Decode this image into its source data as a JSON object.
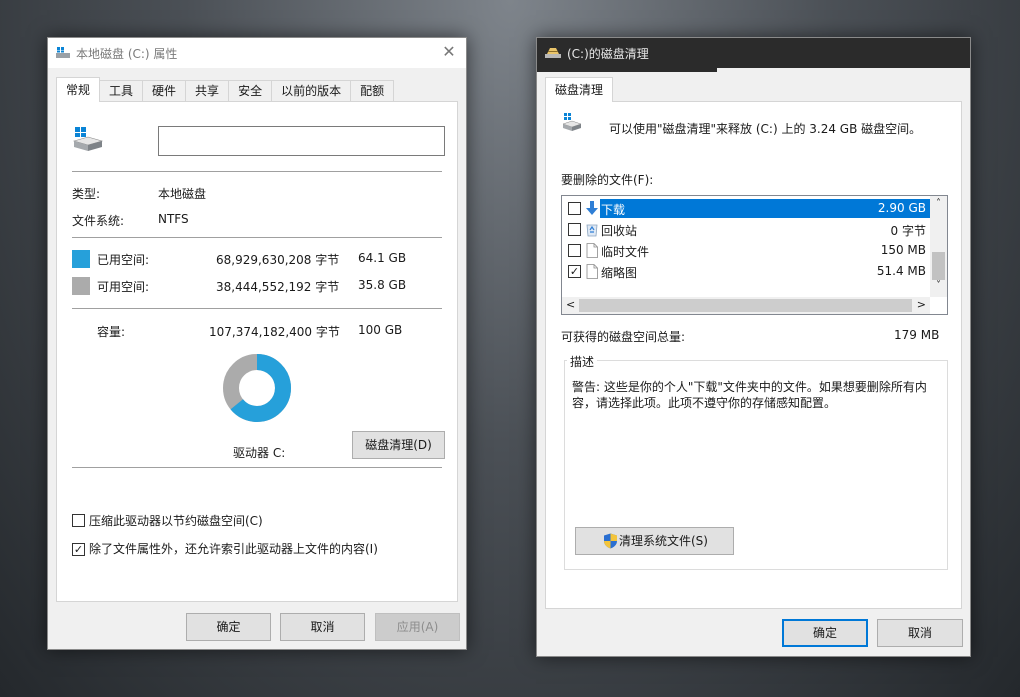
{
  "props": {
    "title": "本地磁盘 (C:) 属性",
    "close_glyph": "✕",
    "tabs": [
      "常规",
      "工具",
      "硬件",
      "共享",
      "安全",
      "以前的版本",
      "配额"
    ],
    "type_label": "类型:",
    "type_value": "本地磁盘",
    "fs_label": "文件系统:",
    "fs_value": "NTFS",
    "used_label": "已用空间:",
    "used_bytes": "68,929,630,208 字节",
    "used_gb": "64.1 GB",
    "free_label": "可用空间:",
    "free_bytes": "38,444,552,192 字节",
    "free_gb": "35.8 GB",
    "capacity_label": "容量:",
    "capacity_bytes": "107,374,182,400 字节",
    "capacity_gb": "100 GB",
    "used_fraction": 0.641,
    "used_color": "#26a0da",
    "free_color": "#ababab",
    "drive_label": "驱动器 C:",
    "cleanup_button": "磁盘清理(D)",
    "compress_label": "压缩此驱动器以节约磁盘空间(C)",
    "compress_checked": false,
    "index_label": "除了文件属性外，还允许索引此驱动器上文件的内容(I)",
    "index_checked": true,
    "ok": "确定",
    "cancel": "取消",
    "apply": "应用(A)"
  },
  "cleanup": {
    "title": "(C:)的磁盘清理",
    "tab": "磁盘清理",
    "intro": "可以使用\"磁盘清理\"来释放  (C:) 上的 3.24 GB 磁盘空间。",
    "files_label": "要删除的文件(F):",
    "files": [
      {
        "name": "下载",
        "size": "2.90 GB",
        "checked": false,
        "selected": true,
        "icon": "download-icon"
      },
      {
        "name": "回收站",
        "size": "0 字节",
        "checked": false,
        "selected": false,
        "icon": "recycle-bin-icon"
      },
      {
        "name": "临时文件",
        "size": "150 MB",
        "checked": false,
        "selected": false,
        "icon": "file-icon"
      },
      {
        "name": "缩略图",
        "size": "51.4 MB",
        "checked": true,
        "selected": false,
        "icon": "file-icon"
      }
    ],
    "total_label": "可获得的磁盘空间总量:",
    "total_value": "179 MB",
    "desc_title": "描述",
    "desc_text": "警告: 这些是你的个人\"下载\"文件夹中的文件。如果想要删除所有内容，请选择此项。此项不遵守你的存储感知配置。",
    "system_button": "清理系统文件(S)",
    "ok": "确定",
    "cancel": "取消",
    "scroll_up": "˄",
    "scroll_down": "˅",
    "scroll_left": "<",
    "scroll_right": ">"
  }
}
